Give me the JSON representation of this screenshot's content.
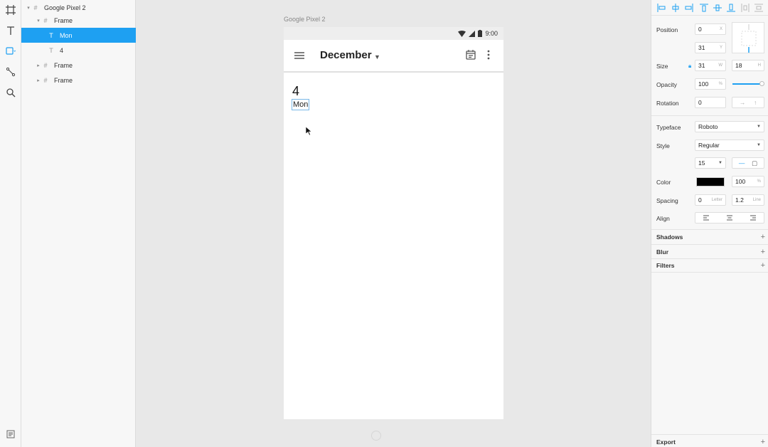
{
  "layers": [
    {
      "name": "Google Pixel 2",
      "type": "frame",
      "indent": 0,
      "expanded": true,
      "selected": false
    },
    {
      "name": "Frame",
      "type": "frame",
      "indent": 1,
      "expanded": true,
      "selected": false
    },
    {
      "name": "Mon",
      "type": "text",
      "indent": 2,
      "expanded": false,
      "selected": true
    },
    {
      "name": "4",
      "type": "text",
      "indent": 2,
      "expanded": false,
      "selected": false
    },
    {
      "name": "Frame",
      "type": "frame",
      "indent": 1,
      "expanded": false,
      "selected": false
    },
    {
      "name": "Frame",
      "type": "frame",
      "indent": 1,
      "expanded": false,
      "selected": false
    }
  ],
  "canvas": {
    "artboard_label": "Google Pixel 2",
    "status_time": "9:00",
    "app_title": "December",
    "day_number": "4",
    "day_name": "Mon"
  },
  "inspector": {
    "position_label": "Position",
    "position_x": "0",
    "position_x_unit": "X",
    "position_y": "31",
    "position_y_unit": "Y",
    "size_label": "Size",
    "size_w": "31",
    "size_w_unit": "W",
    "size_h": "18",
    "size_h_unit": "H",
    "opacity_label": "Opacity",
    "opacity": "100",
    "opacity_unit": "%",
    "rotation_label": "Rotation",
    "rotation": "0",
    "typeface_label": "Typeface",
    "typeface": "Roboto",
    "style_label": "Style",
    "style": "Regular",
    "font_size": "15",
    "color_label": "Color",
    "color_value": "#000000",
    "color_opacity": "100",
    "color_opacity_unit": "%",
    "spacing_label": "Spacing",
    "letter_spacing": "0",
    "letter_unit": "Letter",
    "line_height": "1.2",
    "line_unit": "Line",
    "align_label": "Align",
    "shadows_label": "Shadows",
    "blur_label": "Blur",
    "filters_label": "Filters",
    "export_label": "Export"
  },
  "colors": {
    "accent": "#1ea0f2",
    "panel_bg": "#f7f7f7",
    "canvas_bg": "#e8e8e8"
  }
}
